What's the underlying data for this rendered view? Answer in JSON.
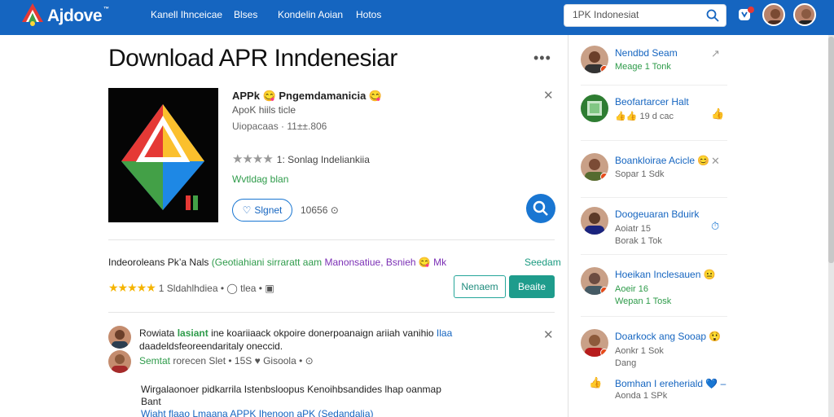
{
  "header": {
    "brand": "Ajdove",
    "brand_mark": "™",
    "nav": [
      "Kanell Ihnceicae",
      "Blses",
      "Kondelin Aoian",
      "Hotos"
    ],
    "search_value": "1PK Indonesiat",
    "search_placeholder": "Search"
  },
  "main": {
    "title": "Download APR Inndenesiar",
    "more": "•••",
    "app": {
      "name": "APPk 😋 Pngemdamanicia 😋",
      "subtitle": "ApoK hiils ticle",
      "size": "Uiopacaas · 11±±.806",
      "rating_stars": "★★★★",
      "rating_text": "1: Sonlag Indeliankiia",
      "status": "Wvtldag blan",
      "follow_label": "Slgnet",
      "count": "10656 ⊙"
    },
    "info": {
      "text1": "Indeoroleans Pk’a Nals",
      "text2": "(Geotiahiani sirraratt aam",
      "text3": "Manonsatiue, Bsnieh",
      "text4": "😋 Mk",
      "side": "Seedam",
      "stars": "★★★★★",
      "stars_text": "1 Sldahlhdiea • ◯ tlea • ▣",
      "btn_outline": "Nenaem",
      "btn_solid": "Beaite"
    },
    "comment": {
      "line1_a": "Rowiata",
      "line1_b": "lasiant",
      "line1_c": "ine koariiaack okpoire donerpoanaign ariiah vanihio",
      "line1_d": "Ilaa",
      "line2": "daadeldsfeoreendaritaly oneccid.",
      "line3_a": "Semtat",
      "line3_b": "rorecen Slet • 15S ♥ Gisoola • ⊙",
      "body1": "Wirgalaonoer pidkarrila Istenbsloopus Kenoihbsandides lhap oanmap",
      "body2": "Bant",
      "body3": "Wiaht flaao Lmaana APPK Ihenoon aPK (Sedandalia)",
      "close": "✕"
    },
    "app_close": "✕"
  },
  "sidebar": {
    "items": [
      {
        "name": "Nendbd Seam",
        "sub": "Meage 1 Tonk",
        "sub_green": true,
        "action": "↗"
      },
      {
        "name": "Beofartarcer Halt",
        "sub": "👍👍 19 d cac",
        "sub_green": false,
        "action": "👍"
      },
      {
        "name": "Boankloirae Acicle 😊",
        "sub": "Sopar 1 Sdk",
        "sub_green": false,
        "action": "✕"
      },
      {
        "name": "Doogeuaran Bduirk",
        "sub": "Aoiatr 15\nBorak 1 Tok",
        "sub_green": false,
        "action": "⏱"
      },
      {
        "name": "Hoeikan Inclesauen 😐",
        "sub": "Aoeir 16\nWepan 1 Tosk",
        "sub_green": true,
        "action": ""
      },
      {
        "name": "Doarkock ang Sooap 😲",
        "sub": "Aonkr 1 Sok\nDang",
        "sub_green": false,
        "action": ""
      },
      {
        "name": "Bomhan I ereheriald 💙 –",
        "sub": "Aonda 1 SPk",
        "sub_green": true,
        "action": "👍"
      }
    ]
  },
  "colors": {
    "header": "#1565c0",
    "accent": "#1976d2",
    "green": "#2e9b4a",
    "teal": "#1e9c8c"
  }
}
